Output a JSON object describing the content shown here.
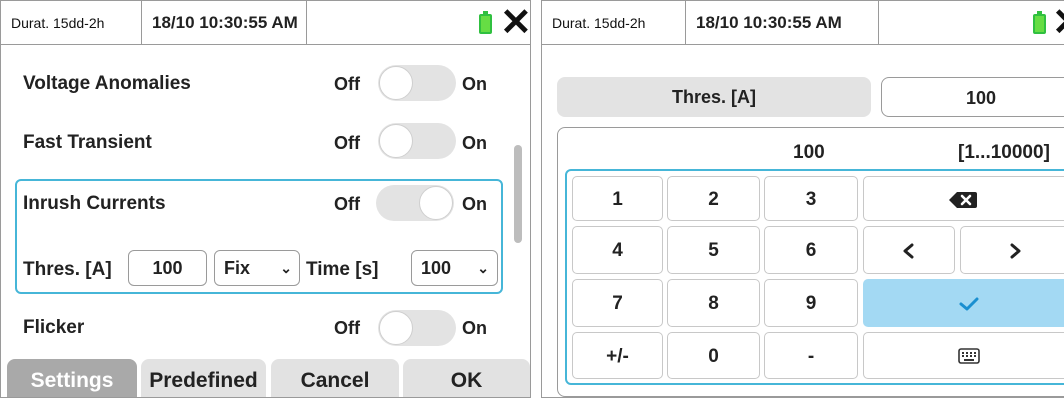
{
  "left_screen": {
    "status": {
      "duration": "Durat. 15dd-2h",
      "datetime": "18/10 10:30:55 AM"
    },
    "rows": [
      {
        "label": "Voltage Anomalies",
        "off": "Off",
        "on": "On",
        "state": "off"
      },
      {
        "label": "Fast Transient",
        "off": "Off",
        "on": "On",
        "state": "off"
      },
      {
        "label": "Inrush Currents",
        "off": "Off",
        "on": "On",
        "state": "on"
      },
      {
        "label": "Flicker",
        "off": "Off",
        "on": "On",
        "state": "off"
      }
    ],
    "inrush_params": {
      "threshold_label": "Thres. [A]",
      "threshold_value": "100",
      "mode_value": "Fix",
      "time_label": "Time [s]",
      "time_value": "100"
    },
    "tabs": [
      "Settings",
      "Predefined",
      "Cancel",
      "OK"
    ],
    "active_tab": "Settings"
  },
  "right_screen": {
    "status": {
      "duration": "Durat. 15dd-2h",
      "datetime": "18/10 10:30:55 AM"
    },
    "param_label": "Thres. [A]",
    "param_value": "100",
    "entry_value": "100",
    "range": "[1...10000]",
    "keys": [
      "1",
      "2",
      "3",
      "4",
      "5",
      "6",
      "7",
      "8",
      "9",
      "+/-",
      "0",
      "-"
    ]
  },
  "colors": {
    "highlight": "#46b6d8",
    "confirm_key": "#a3d9f3",
    "battery": "#66dd44",
    "active_tab": "#a9a9a9"
  },
  "icons": [
    "battery-icon",
    "close-icon",
    "chevron-down-icon",
    "backspace-icon",
    "arrow-left-icon",
    "arrow-right-icon",
    "check-icon",
    "keyboard-icon"
  ]
}
